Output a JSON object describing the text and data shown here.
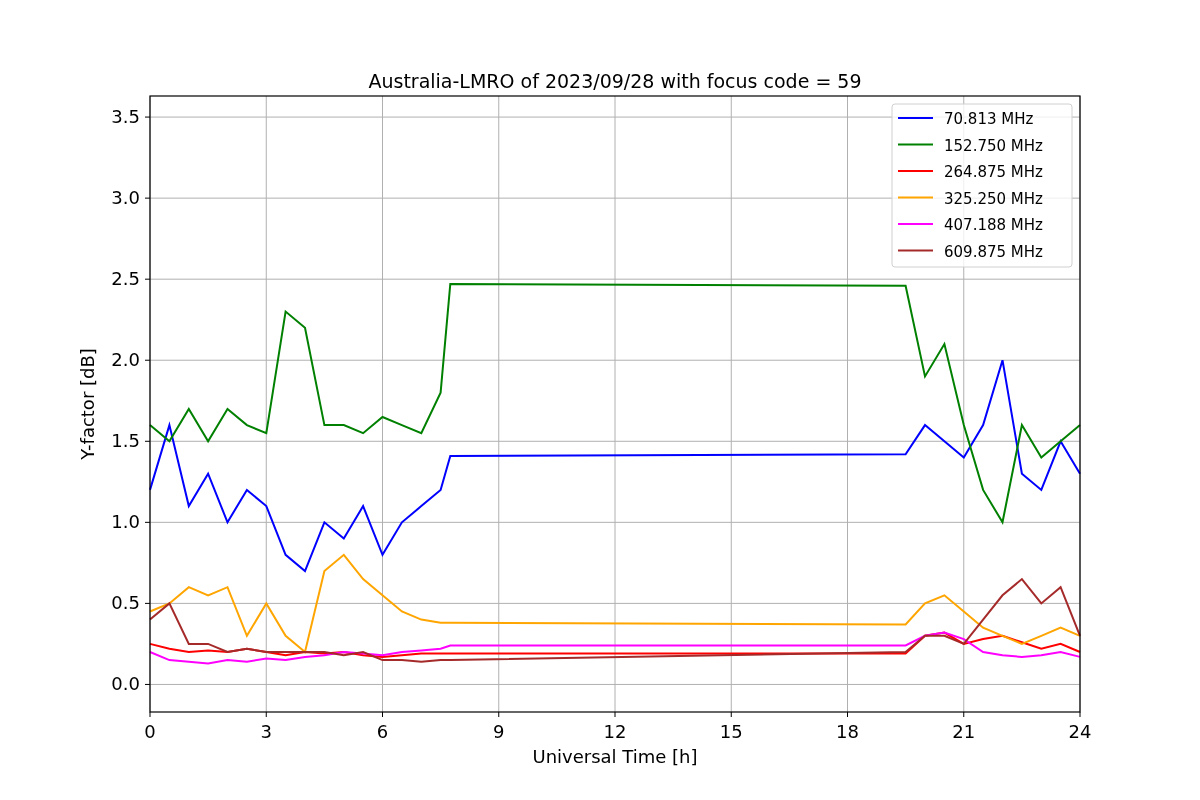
{
  "chart_data": {
    "type": "line",
    "title": "Australia-LMRO of 2023/09/28 with focus code = 59",
    "xlabel": "Universal Time [h]",
    "ylabel": "Y-factor [dB]",
    "x": [
      0,
      0.5,
      1,
      1.5,
      2,
      2.5,
      3,
      3.5,
      4,
      4.5,
      5,
      5.5,
      6,
      6.5,
      7,
      7.5,
      7.75,
      19.5,
      20,
      20.5,
      21,
      21.5,
      22,
      22.5,
      23,
      23.5,
      24
    ],
    "series": [
      {
        "name": "70.813 MHz",
        "color": "#0000ff",
        "values": [
          1.2,
          1.6,
          1.1,
          1.3,
          1.0,
          1.2,
          1.1,
          0.8,
          0.7,
          1.0,
          0.9,
          1.1,
          0.8,
          1.0,
          1.1,
          1.2,
          1.41,
          1.42,
          1.6,
          1.5,
          1.4,
          1.6,
          2.0,
          1.3,
          1.2,
          1.5,
          1.3
        ]
      },
      {
        "name": "152.750 MHz",
        "color": "#008000",
        "values": [
          1.6,
          1.5,
          1.7,
          1.5,
          1.7,
          1.6,
          1.55,
          2.3,
          2.2,
          1.6,
          1.6,
          1.55,
          1.65,
          1.6,
          1.55,
          1.8,
          2.47,
          2.46,
          1.9,
          2.1,
          1.6,
          1.2,
          1.0,
          1.6,
          1.4,
          1.5,
          1.6
        ]
      },
      {
        "name": "264.875 MHz",
        "color": "#ff0000",
        "values": [
          0.25,
          0.22,
          0.2,
          0.21,
          0.2,
          0.22,
          0.2,
          0.18,
          0.2,
          0.19,
          0.2,
          0.18,
          0.17,
          0.18,
          0.19,
          0.19,
          0.19,
          0.19,
          0.3,
          0.32,
          0.25,
          0.28,
          0.3,
          0.26,
          0.22,
          0.25,
          0.2
        ]
      },
      {
        "name": "325.250 MHz",
        "color": "#ffa500",
        "values": [
          0.45,
          0.5,
          0.6,
          0.55,
          0.6,
          0.3,
          0.5,
          0.3,
          0.2,
          0.7,
          0.8,
          0.65,
          0.55,
          0.45,
          0.4,
          0.38,
          0.38,
          0.37,
          0.5,
          0.55,
          0.45,
          0.35,
          0.3,
          0.25,
          0.3,
          0.35,
          0.3
        ]
      },
      {
        "name": "407.188 MHz",
        "color": "#ff00ff",
        "values": [
          0.2,
          0.15,
          0.14,
          0.13,
          0.15,
          0.14,
          0.16,
          0.15,
          0.17,
          0.18,
          0.2,
          0.19,
          0.18,
          0.2,
          0.21,
          0.22,
          0.24,
          0.24,
          0.3,
          0.32,
          0.28,
          0.2,
          0.18,
          0.17,
          0.18,
          0.2,
          0.17
        ]
      },
      {
        "name": "609.875 MHz",
        "color": "#a52a2a",
        "values": [
          0.4,
          0.5,
          0.25,
          0.25,
          0.2,
          0.22,
          0.2,
          0.2,
          0.2,
          0.2,
          0.18,
          0.2,
          0.15,
          0.15,
          0.14,
          0.15,
          0.15,
          0.2,
          0.3,
          0.3,
          0.25,
          0.4,
          0.55,
          0.65,
          0.5,
          0.6,
          0.3
        ]
      }
    ],
    "grid": true,
    "legend": true,
    "xlim": [
      0,
      24
    ],
    "ylim": [
      -0.17,
      3.63
    ],
    "xticks": [
      0,
      3,
      6,
      9,
      12,
      15,
      18,
      21,
      24
    ],
    "yticks": [
      {
        "value": 0,
        "label": "0.0"
      },
      {
        "value": 0.5,
        "label": "0.5"
      },
      {
        "value": 1,
        "label": "1.0"
      },
      {
        "value": 1.5,
        "label": "1.5"
      },
      {
        "value": 2,
        "label": "2.0"
      },
      {
        "value": 2.5,
        "label": "2.5"
      },
      {
        "value": 3,
        "label": "3.0"
      },
      {
        "value": 3.5,
        "label": "3.5"
      }
    ]
  }
}
